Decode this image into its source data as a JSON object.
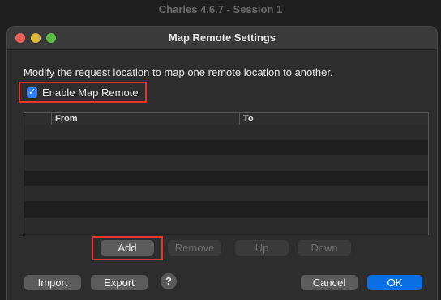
{
  "app": {
    "title": "Charles 4.6.7 - Session 1"
  },
  "dialog": {
    "title": "Map Remote Settings",
    "description": "Modify the request location to map one remote location to another.",
    "enable": {
      "label": "Enable Map Remote",
      "checked": true
    }
  },
  "table": {
    "columns": [
      "",
      "From",
      "To"
    ],
    "rows": []
  },
  "table_buttons": {
    "add": "Add",
    "remove": "Remove",
    "up": "Up",
    "down": "Down"
  },
  "footer": {
    "import": "Import",
    "export": "Export",
    "help": "?",
    "cancel": "Cancel",
    "ok": "OK"
  },
  "colors": {
    "highlight": "#e8322a",
    "accent": "#0a6fe3",
    "close": "#ec5f57",
    "minimize": "#dcb637",
    "maximize": "#5cbf44"
  }
}
